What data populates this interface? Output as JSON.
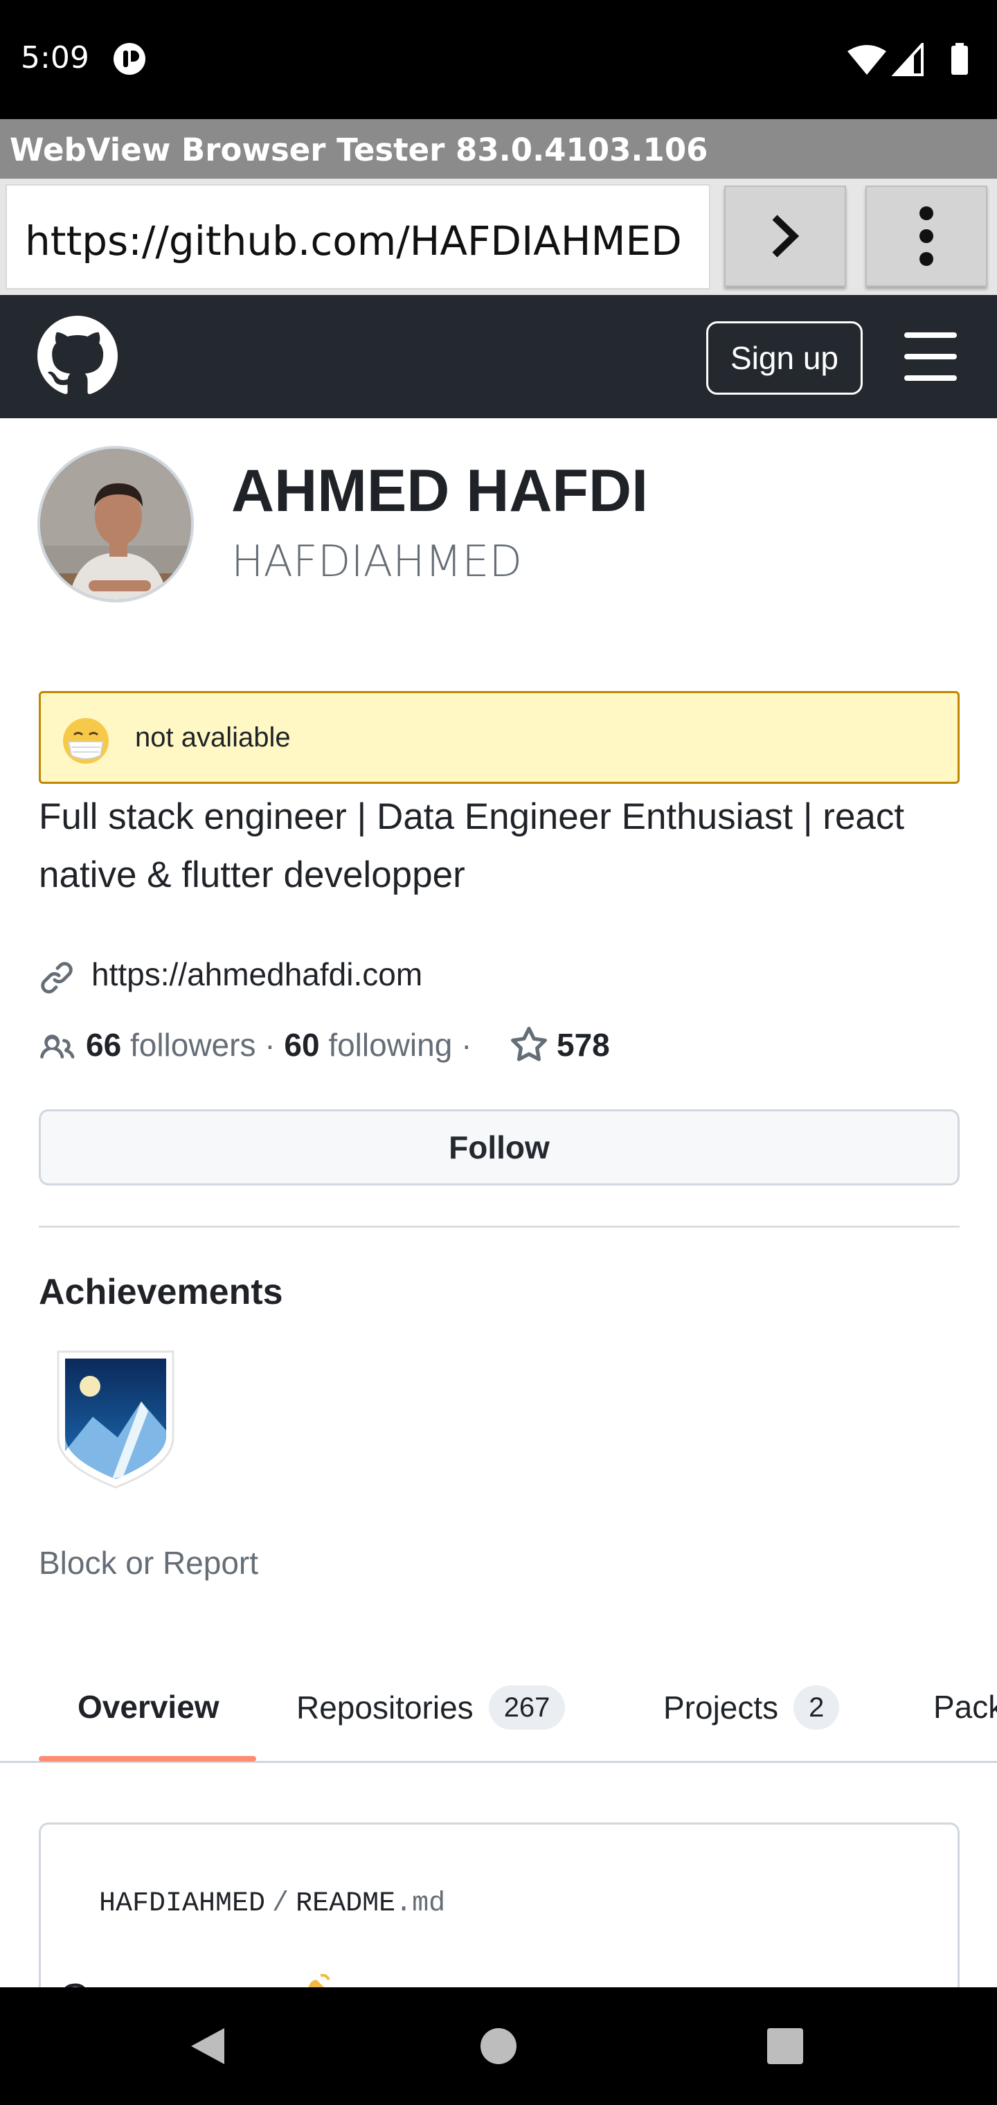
{
  "status_bar": {
    "time": "5:09"
  },
  "app": {
    "title": "WebView Browser Tester 83.0.4103.106"
  },
  "url_bar": {
    "url": "https://github.com/HAFDIAHMED"
  },
  "header": {
    "signup_label": "Sign up"
  },
  "profile": {
    "full_name": "AHMED HAFDI",
    "username": "HAFDIAHMED",
    "status_text": "not avaliable",
    "bio": "Full stack engineer | Data Engineer Enthusiast | react native & flutter developper",
    "website": "https://ahmedhafdi.com",
    "followers_count": "66",
    "followers_label": "followers",
    "following_count": "60",
    "following_label": "following",
    "separator": "·",
    "stars_count": "578",
    "follow_label": "Follow",
    "achievements_title": "Achievements",
    "block_report_label": "Block or Report"
  },
  "tabs": [
    {
      "label": "Overview",
      "count": null
    },
    {
      "label": "Repositories",
      "count": "267"
    },
    {
      "label": "Projects",
      "count": "2"
    },
    {
      "label": "Pack",
      "count": null
    }
  ],
  "readme": {
    "owner": "HAFDIAHMED",
    "sep": "/",
    "file": "README",
    "ext": ".md"
  },
  "colors": {
    "github_header": "#24292f",
    "status_bg": "#fff8c5",
    "status_border": "#bf8700",
    "tab_underline": "#fd8c73"
  }
}
